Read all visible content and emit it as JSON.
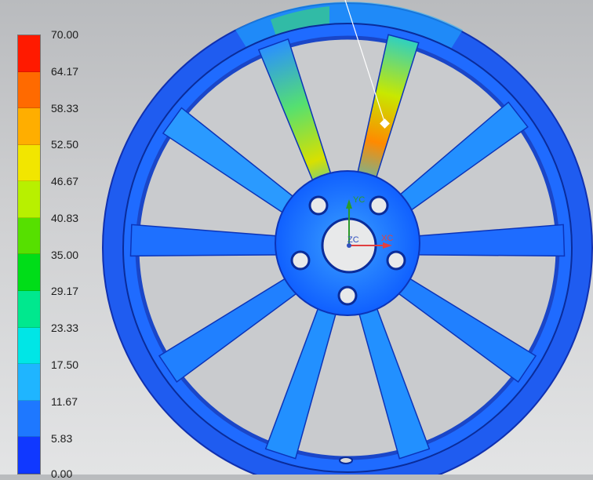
{
  "legend": {
    "labels": [
      "70.00",
      "64.17",
      "58.33",
      "52.50",
      "46.67",
      "40.83",
      "35.00",
      "29.17",
      "23.33",
      "17.50",
      "11.67",
      "5.83",
      "0.00"
    ],
    "colors": [
      "#ff1a00",
      "#ff6a00",
      "#ffae00",
      "#f2e600",
      "#b8f000",
      "#56e000",
      "#00dd18",
      "#00e88e",
      "#00e6e6",
      "#1fb5ff",
      "#1e78ff",
      "#1038ff",
      "#0000ff"
    ]
  },
  "viewport": {
    "axes": {
      "x": "XC",
      "y": "YC",
      "z": "ZC"
    },
    "axis_colors": {
      "x": "#e04040",
      "y": "#2a9a2a",
      "z": "#3050c0"
    }
  }
}
